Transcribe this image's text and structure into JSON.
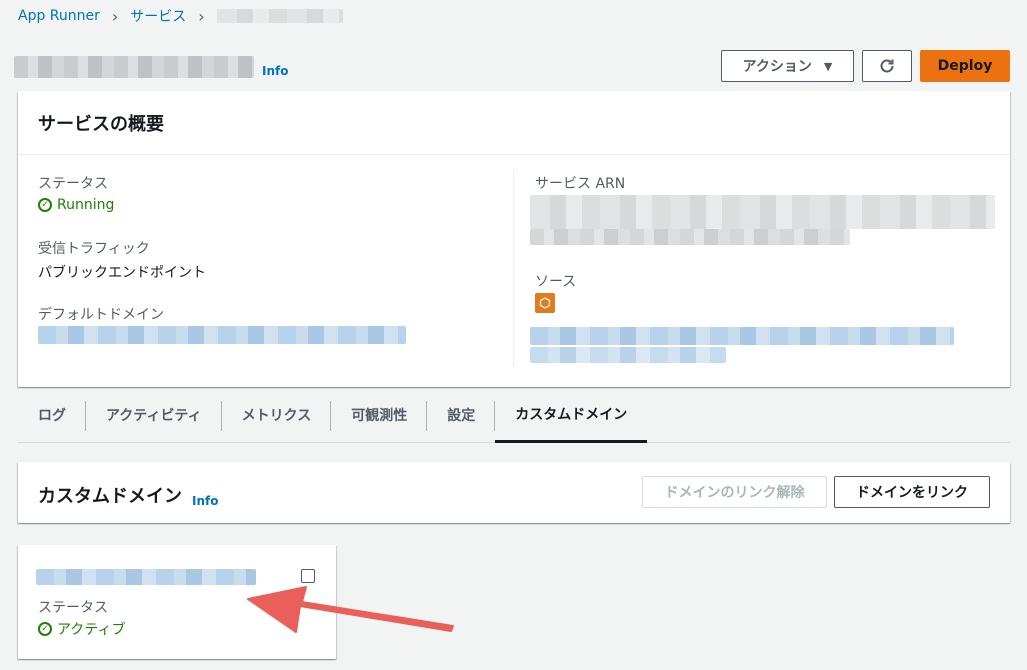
{
  "breadcrumb": {
    "root": "App Runner",
    "services": "サービス"
  },
  "header": {
    "info": "Info",
    "actions_label": "アクション",
    "refresh_icon": "refresh-icon",
    "deploy_label": "Deploy"
  },
  "overview": {
    "title": "サービスの概要",
    "status_label": "ステータス",
    "status_value": "Running",
    "traffic_label": "受信トラフィック",
    "traffic_value": "パブリックエンドポイント",
    "domain_label": "デフォルトドメイン",
    "arn_label": "サービス ARN",
    "source_label": "ソース",
    "source_icon": "ecr-repository-icon"
  },
  "tabs": [
    {
      "label": "ログ"
    },
    {
      "label": "アクティビティ"
    },
    {
      "label": "メトリクス"
    },
    {
      "label": "可観測性"
    },
    {
      "label": "設定"
    },
    {
      "label": "カスタムドメイン"
    }
  ],
  "custom_domains": {
    "title": "カスタムドメイン",
    "info": "Info",
    "unlink_label": "ドメインのリンク解除",
    "link_label": "ドメインをリンク",
    "card": {
      "status_label": "ステータス",
      "status_value": "アクティブ"
    }
  },
  "colors": {
    "accent": "#0073bb",
    "primary_button": "#ec7211",
    "success": "#1d8102",
    "annotation_arrow": "#e9605a"
  }
}
